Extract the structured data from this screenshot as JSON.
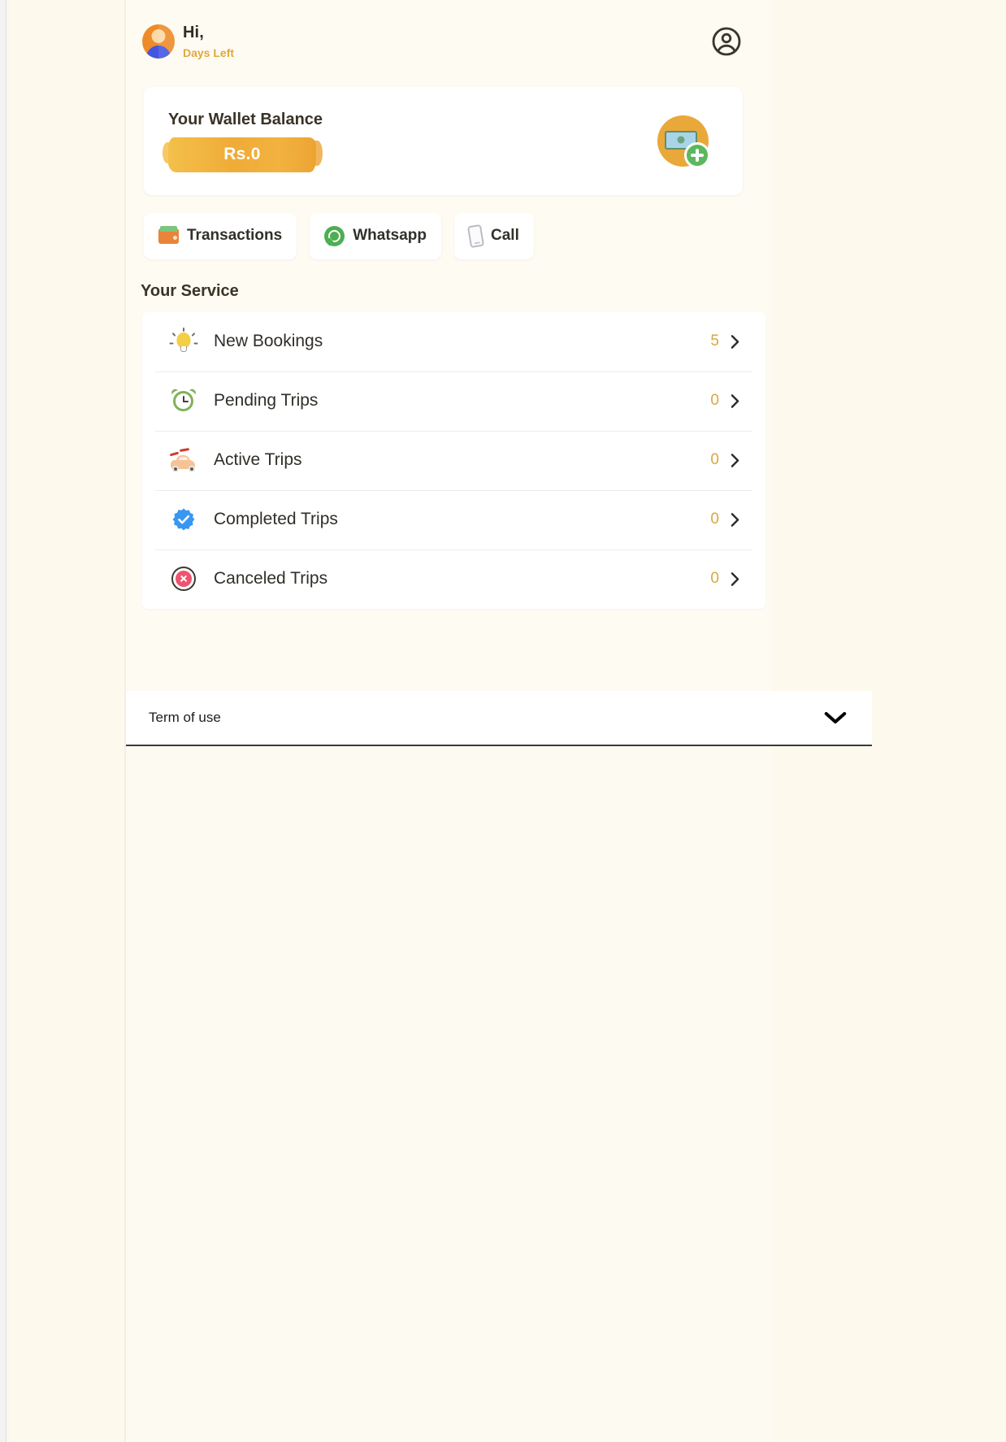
{
  "header": {
    "greeting": "Hi,",
    "days_left": "Days Left",
    "avatar_name": "user-avatar",
    "account_icon": "account-circle-icon"
  },
  "wallet": {
    "title": "Your Wallet Balance",
    "amount": "Rs.0",
    "add_money_icon": "money-add-icon",
    "card_bg": "#ffffff",
    "brush_color": "#f0ab37"
  },
  "actions": [
    {
      "label": "Transactions",
      "icon": "wallet-icon"
    },
    {
      "label": "Whatsapp",
      "icon": "whatsapp-icon"
    },
    {
      "label": "Call",
      "icon": "phone-icon"
    }
  ],
  "services": {
    "title": "Your Service",
    "rows": [
      {
        "label": "New Bookings",
        "count": "5",
        "icon": "lightbulb-icon"
      },
      {
        "label": "Pending Trips",
        "count": "0",
        "icon": "alarm-clock-icon"
      },
      {
        "label": "Active Trips",
        "count": "0",
        "icon": "car-icon"
      },
      {
        "label": "Completed Trips",
        "count": "0",
        "icon": "verified-badge-icon"
      },
      {
        "label": "Canceled Trips",
        "count": "0",
        "icon": "cancel-circle-icon"
      }
    ]
  },
  "footer": {
    "term_label": "Term of use",
    "expand_icon": "chevron-down-icon"
  },
  "colors": {
    "page_bg": "#fdf9ed",
    "column_bg": "#fefbf3",
    "accent_orange": "#e9a83a",
    "count_gold": "#d9a73f",
    "text_dark": "#312e28"
  }
}
